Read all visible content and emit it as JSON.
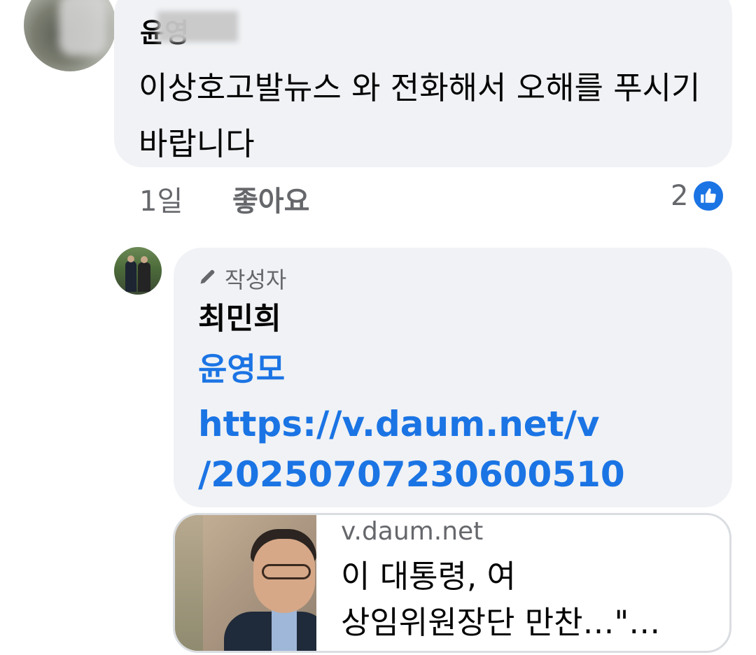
{
  "comment": {
    "author": "윤영",
    "text": "이상호고발뉴스 와 전화해서 오해를 푸시기 바랍니다",
    "time": "1일",
    "like_label": "좋아요",
    "reaction_count": "2",
    "reaction_icon": "thumbs-up-icon",
    "colors": {
      "bubble": "#f0f2f5",
      "meta": "#65676b",
      "accent": "#1b74e4"
    }
  },
  "reply": {
    "badge_icon": "pencil-icon",
    "badge_label": "작성자",
    "author": "최민희",
    "mention": "윤영모",
    "link_line1": "https://v.daum.net/v",
    "link_line2": "/20250707230600510",
    "preview": {
      "domain": "v.daum.net",
      "title_line1": "이 대통령, 여",
      "title_line2": "상임위원장단 만찬…\"…"
    }
  }
}
